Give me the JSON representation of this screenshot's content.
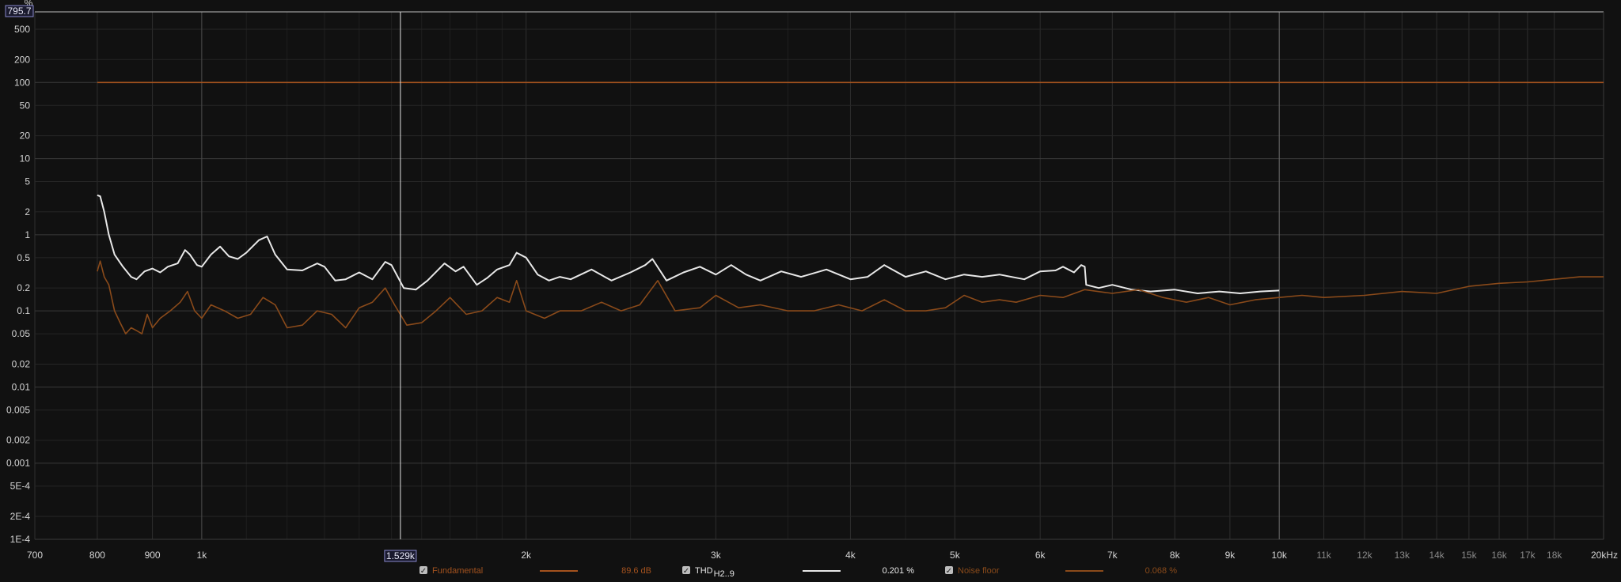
{
  "chart_data": {
    "type": "line",
    "title": "",
    "xlabel": "",
    "ylabel": "%",
    "x_scale": "log",
    "y_scale": "log",
    "xlim": [
      700,
      20000
    ],
    "ylim": [
      0.0001,
      1000
    ],
    "grid": true,
    "x_ticks": [
      {
        "value": 700,
        "label": "700",
        "major": true
      },
      {
        "value": 800,
        "label": "800",
        "major": true
      },
      {
        "value": 900,
        "label": "900",
        "major": true
      },
      {
        "value": 1000,
        "label": "1k",
        "major": true
      },
      {
        "value": 2000,
        "label": "2k",
        "major": true
      },
      {
        "value": 3000,
        "label": "3k",
        "major": true
      },
      {
        "value": 4000,
        "label": "4k",
        "major": true
      },
      {
        "value": 5000,
        "label": "5k",
        "major": true
      },
      {
        "value": 6000,
        "label": "6k",
        "major": true
      },
      {
        "value": 7000,
        "label": "7k",
        "major": true
      },
      {
        "value": 8000,
        "label": "8k",
        "major": true
      },
      {
        "value": 9000,
        "label": "9k",
        "major": true
      },
      {
        "value": 10000,
        "label": "10k",
        "major": true
      },
      {
        "value": 11000,
        "label": "11k",
        "major": false
      },
      {
        "value": 12000,
        "label": "12k",
        "major": false
      },
      {
        "value": 13000,
        "label": "13k",
        "major": false
      },
      {
        "value": 14000,
        "label": "14k",
        "major": false
      },
      {
        "value": 15000,
        "label": "15k",
        "major": false
      },
      {
        "value": 16000,
        "label": "16k",
        "major": false
      },
      {
        "value": 17000,
        "label": "17k",
        "major": false
      },
      {
        "value": 18000,
        "label": "18k",
        "major": false
      },
      {
        "value": 20000,
        "label": "20kHz",
        "major": true
      }
    ],
    "y_ticks": [
      {
        "value": 500,
        "label": "500"
      },
      {
        "value": 200,
        "label": "200"
      },
      {
        "value": 100,
        "label": "100"
      },
      {
        "value": 50,
        "label": "50"
      },
      {
        "value": 20,
        "label": "20"
      },
      {
        "value": 10,
        "label": "10"
      },
      {
        "value": 5,
        "label": "5"
      },
      {
        "value": 2,
        "label": "2"
      },
      {
        "value": 1,
        "label": "1"
      },
      {
        "value": 0.5,
        "label": "0.5"
      },
      {
        "value": 0.2,
        "label": "0.2"
      },
      {
        "value": 0.1,
        "label": "0.1"
      },
      {
        "value": 0.05,
        "label": "0.05"
      },
      {
        "value": 0.02,
        "label": "0.02"
      },
      {
        "value": 0.01,
        "label": "0.01"
      },
      {
        "value": 0.005,
        "label": "0.005"
      },
      {
        "value": 0.002,
        "label": "0.002"
      },
      {
        "value": 0.001,
        "label": "0.001"
      },
      {
        "value": 0.0005,
        "label": "5E-4"
      },
      {
        "value": 0.0002,
        "label": "2E-4"
      },
      {
        "value": 0.0001,
        "label": "1E-4"
      }
    ],
    "cursor": {
      "x": 1529,
      "y": 795.7,
      "x_label": "1.529k",
      "y_label": "795.7"
    },
    "series": [
      {
        "name": "Fundamental",
        "color": "#a4521e",
        "legend_value": "89.6 dB",
        "points": [
          [
            800,
            100
          ],
          [
            20000,
            100
          ]
        ]
      },
      {
        "name": "THD",
        "name_sub": "H2..9",
        "color": "#e8e8e8",
        "legend_value": "0.201 %",
        "points": [
          [
            800,
            3.3
          ],
          [
            805,
            3.2
          ],
          [
            812,
            2.0
          ],
          [
            820,
            1.0
          ],
          [
            830,
            0.55
          ],
          [
            845,
            0.38
          ],
          [
            860,
            0.28
          ],
          [
            870,
            0.26
          ],
          [
            885,
            0.33
          ],
          [
            900,
            0.36
          ],
          [
            915,
            0.32
          ],
          [
            930,
            0.38
          ],
          [
            950,
            0.42
          ],
          [
            965,
            0.63
          ],
          [
            975,
            0.55
          ],
          [
            990,
            0.4
          ],
          [
            1000,
            0.38
          ],
          [
            1020,
            0.55
          ],
          [
            1040,
            0.7
          ],
          [
            1060,
            0.52
          ],
          [
            1080,
            0.48
          ],
          [
            1100,
            0.58
          ],
          [
            1130,
            0.85
          ],
          [
            1150,
            0.95
          ],
          [
            1170,
            0.55
          ],
          [
            1200,
            0.35
          ],
          [
            1240,
            0.34
          ],
          [
            1280,
            0.42
          ],
          [
            1300,
            0.38
          ],
          [
            1330,
            0.25
          ],
          [
            1360,
            0.26
          ],
          [
            1400,
            0.32
          ],
          [
            1440,
            0.26
          ],
          [
            1480,
            0.44
          ],
          [
            1500,
            0.4
          ],
          [
            1540,
            0.2
          ],
          [
            1580,
            0.19
          ],
          [
            1620,
            0.25
          ],
          [
            1680,
            0.42
          ],
          [
            1720,
            0.33
          ],
          [
            1750,
            0.38
          ],
          [
            1800,
            0.22
          ],
          [
            1840,
            0.27
          ],
          [
            1880,
            0.35
          ],
          [
            1930,
            0.4
          ],
          [
            1960,
            0.58
          ],
          [
            2000,
            0.5
          ],
          [
            2050,
            0.3
          ],
          [
            2100,
            0.25
          ],
          [
            2150,
            0.28
          ],
          [
            2200,
            0.26
          ],
          [
            2300,
            0.35
          ],
          [
            2400,
            0.25
          ],
          [
            2500,
            0.32
          ],
          [
            2580,
            0.4
          ],
          [
            2620,
            0.48
          ],
          [
            2700,
            0.25
          ],
          [
            2800,
            0.32
          ],
          [
            2900,
            0.38
          ],
          [
            3000,
            0.3
          ],
          [
            3100,
            0.4
          ],
          [
            3200,
            0.3
          ],
          [
            3300,
            0.25
          ],
          [
            3450,
            0.33
          ],
          [
            3600,
            0.28
          ],
          [
            3800,
            0.35
          ],
          [
            4000,
            0.26
          ],
          [
            4150,
            0.28
          ],
          [
            4300,
            0.4
          ],
          [
            4500,
            0.28
          ],
          [
            4700,
            0.33
          ],
          [
            4900,
            0.26
          ],
          [
            5100,
            0.3
          ],
          [
            5300,
            0.28
          ],
          [
            5500,
            0.3
          ],
          [
            5800,
            0.26
          ],
          [
            6000,
            0.33
          ],
          [
            6200,
            0.34
          ],
          [
            6300,
            0.38
          ],
          [
            6450,
            0.32
          ],
          [
            6550,
            0.4
          ],
          [
            6600,
            0.38
          ],
          [
            6620,
            0.22
          ],
          [
            6800,
            0.2
          ],
          [
            7000,
            0.22
          ],
          [
            7300,
            0.19
          ],
          [
            7600,
            0.18
          ],
          [
            8000,
            0.19
          ],
          [
            8400,
            0.17
          ],
          [
            8800,
            0.18
          ],
          [
            9200,
            0.17
          ],
          [
            9600,
            0.18
          ],
          [
            10000,
            0.185
          ]
        ]
      },
      {
        "name": "Noise floor",
        "color": "#8a4a1a",
        "legend_value": "0.068 %",
        "points": [
          [
            800,
            0.33
          ],
          [
            805,
            0.45
          ],
          [
            812,
            0.28
          ],
          [
            820,
            0.22
          ],
          [
            830,
            0.1
          ],
          [
            840,
            0.07
          ],
          [
            850,
            0.05
          ],
          [
            860,
            0.06
          ],
          [
            870,
            0.055
          ],
          [
            880,
            0.05
          ],
          [
            890,
            0.09
          ],
          [
            900,
            0.06
          ],
          [
            915,
            0.08
          ],
          [
            935,
            0.1
          ],
          [
            955,
            0.13
          ],
          [
            970,
            0.18
          ],
          [
            985,
            0.1
          ],
          [
            1000,
            0.08
          ],
          [
            1020,
            0.12
          ],
          [
            1050,
            0.1
          ],
          [
            1080,
            0.08
          ],
          [
            1110,
            0.09
          ],
          [
            1140,
            0.15
          ],
          [
            1170,
            0.12
          ],
          [
            1200,
            0.06
          ],
          [
            1240,
            0.065
          ],
          [
            1280,
            0.1
          ],
          [
            1320,
            0.09
          ],
          [
            1360,
            0.06
          ],
          [
            1400,
            0.11
          ],
          [
            1440,
            0.13
          ],
          [
            1480,
            0.2
          ],
          [
            1510,
            0.12
          ],
          [
            1550,
            0.065
          ],
          [
            1600,
            0.07
          ],
          [
            1650,
            0.1
          ],
          [
            1700,
            0.15
          ],
          [
            1760,
            0.09
          ],
          [
            1820,
            0.1
          ],
          [
            1880,
            0.15
          ],
          [
            1930,
            0.13
          ],
          [
            1960,
            0.25
          ],
          [
            2000,
            0.1
          ],
          [
            2080,
            0.08
          ],
          [
            2150,
            0.1
          ],
          [
            2250,
            0.1
          ],
          [
            2350,
            0.13
          ],
          [
            2450,
            0.1
          ],
          [
            2550,
            0.12
          ],
          [
            2650,
            0.25
          ],
          [
            2750,
            0.1
          ],
          [
            2900,
            0.11
          ],
          [
            3000,
            0.16
          ],
          [
            3150,
            0.11
          ],
          [
            3300,
            0.12
          ],
          [
            3500,
            0.1
          ],
          [
            3700,
            0.1
          ],
          [
            3900,
            0.12
          ],
          [
            4100,
            0.1
          ],
          [
            4300,
            0.14
          ],
          [
            4500,
            0.1
          ],
          [
            4700,
            0.1
          ],
          [
            4900,
            0.11
          ],
          [
            5100,
            0.16
          ],
          [
            5300,
            0.13
          ],
          [
            5500,
            0.14
          ],
          [
            5700,
            0.13
          ],
          [
            6000,
            0.16
          ],
          [
            6300,
            0.15
          ],
          [
            6600,
            0.19
          ],
          [
            7000,
            0.17
          ],
          [
            7400,
            0.19
          ],
          [
            7800,
            0.15
          ],
          [
            8200,
            0.13
          ],
          [
            8600,
            0.15
          ],
          [
            9000,
            0.12
          ],
          [
            9500,
            0.14
          ],
          [
            10000,
            0.15
          ],
          [
            10500,
            0.16
          ],
          [
            11000,
            0.15
          ],
          [
            12000,
            0.16
          ],
          [
            13000,
            0.18
          ],
          [
            14000,
            0.17
          ],
          [
            15000,
            0.21
          ],
          [
            16000,
            0.23
          ],
          [
            17000,
            0.24
          ],
          [
            18000,
            0.26
          ],
          [
            19000,
            0.28
          ],
          [
            20000,
            0.28
          ]
        ]
      }
    ]
  },
  "legend": [
    {
      "label": "Fundamental",
      "sub": "",
      "value": "89.6 dB",
      "checked": true,
      "color": "#a4521e"
    },
    {
      "label": "THD",
      "sub": "H2..9",
      "value": "0.201 %",
      "checked": true,
      "color": "#e8e8e8"
    },
    {
      "label": "Noise floor",
      "sub": "",
      "value": "0.068 %",
      "checked": true,
      "color": "#8a4a1a"
    }
  ]
}
